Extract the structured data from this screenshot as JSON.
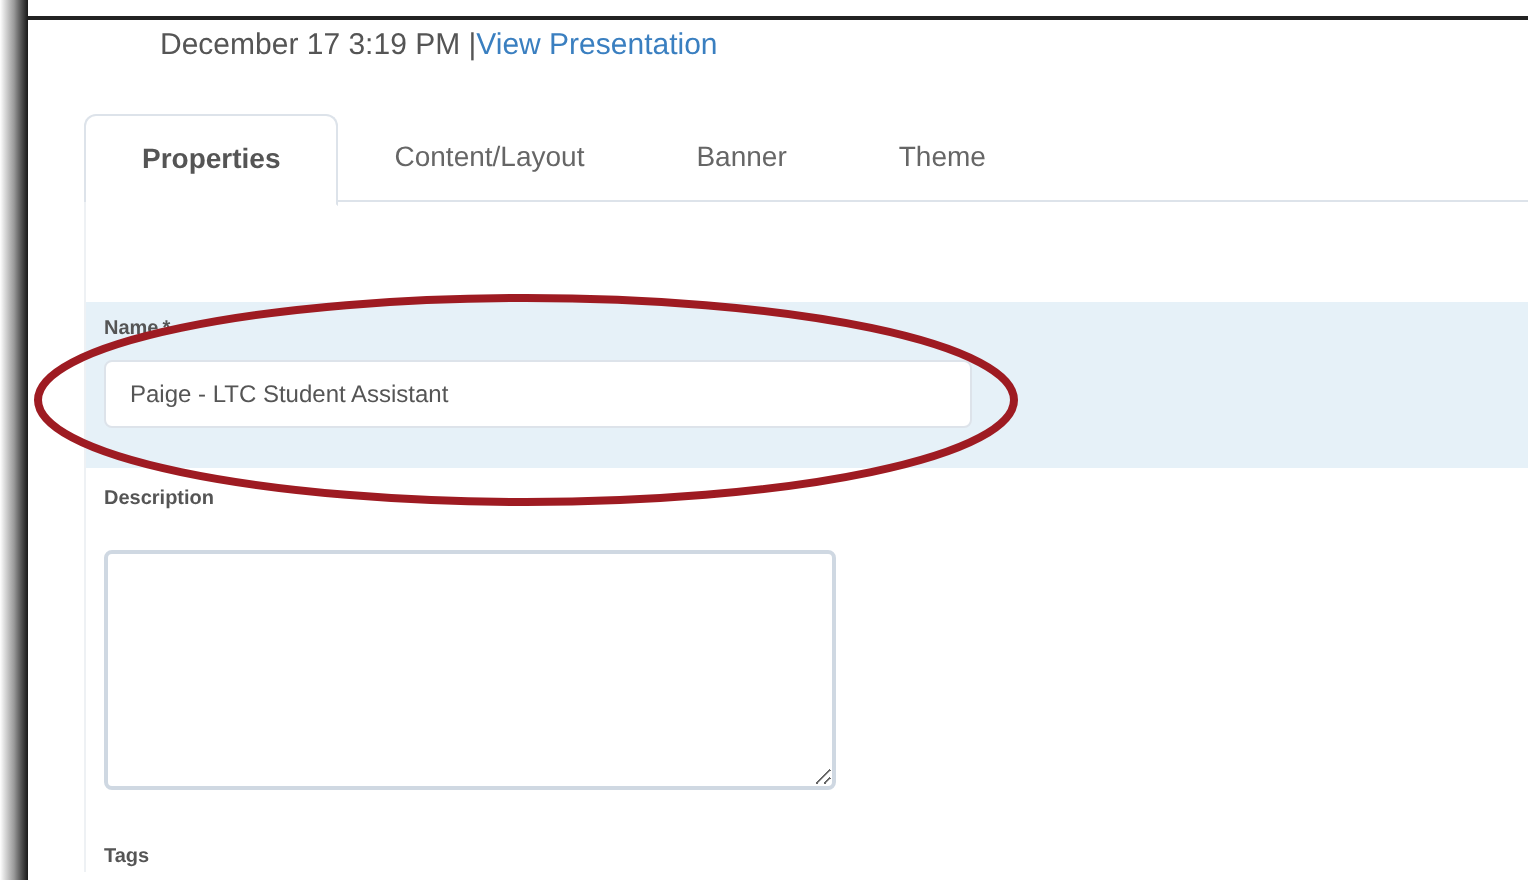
{
  "header": {
    "date": "December 17 3:19 PM |",
    "link": "View Presentation"
  },
  "tabs": [
    {
      "label": "Properties",
      "selected": true
    },
    {
      "label": "Content/Layout",
      "selected": false
    },
    {
      "label": "Banner",
      "selected": false
    },
    {
      "label": "Theme",
      "selected": false
    }
  ],
  "name_field": {
    "label": "Name",
    "required_mark": "*",
    "value": "Paige - LTC Student Assistant",
    "highlighted": true
  },
  "description_field": {
    "label": "Description"
  },
  "tags_label": "Tags"
}
